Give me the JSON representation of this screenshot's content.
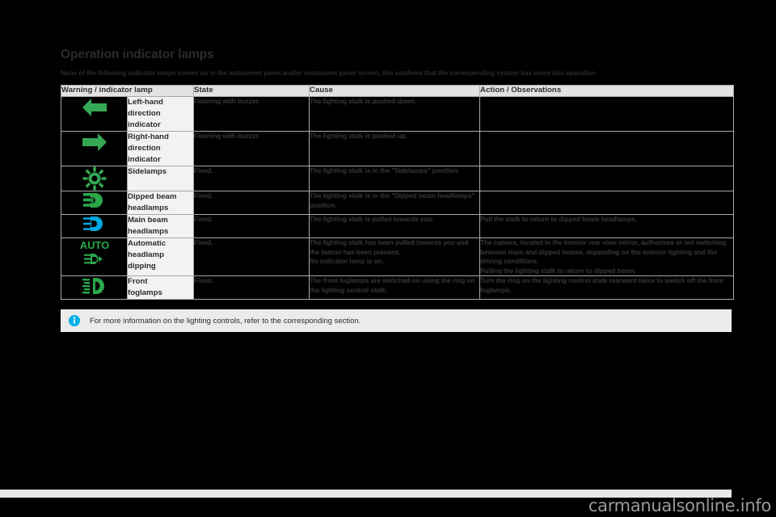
{
  "page": {
    "title": "Operation indicator lamps",
    "subtitle": "None of the following indicator lamps comes on in the instrument panel and/or instrument panel screen, this confirms that the corresponding system has come into operation."
  },
  "table": {
    "headers": {
      "warning": "Warning / indicator lamp",
      "state": "State",
      "cause": "Cause",
      "action": "Action / Observations"
    },
    "rows": [
      {
        "icon": "left-arrow-indicator-icon",
        "icon_color": "#34a853",
        "name": "Left-hand\ndirection indicator",
        "state": "Flashing with buzzer.",
        "cause": "The lighting stalk is pushed down.",
        "action": ""
      },
      {
        "icon": "right-arrow-indicator-icon",
        "icon_color": "#34a853",
        "name": "Right-hand\ndirection indicator",
        "state": "Flashing with buzzer.",
        "cause": "The lighting stalk is pushed up.",
        "action": ""
      },
      {
        "icon": "sidelamps-sunburst-icon",
        "icon_color": "#34a853",
        "name": "Sidelamps",
        "state": "Fixed.",
        "cause": "The lighting stalk is in the \"Sidelamps\" position.",
        "action": ""
      },
      {
        "icon": "dipped-beam-headlamp-icon",
        "icon_color": "#2aa84a",
        "name": "Dipped beam\nheadlamps",
        "state": "Fixed.",
        "cause": "The lighting stalk is in the \"Dipped beam headlamps\" position.",
        "action": ""
      },
      {
        "icon": "main-beam-headlamp-icon",
        "icon_color": "#00a8e0",
        "name": "Main beam\nheadlamps",
        "state": "Fixed.",
        "cause": "The lighting stalk is pulled towards you.",
        "action": "Pull the stalk to return to dipped beam headlamps."
      },
      {
        "icon": "automatic-headlamp-dipping-icon",
        "icon_color": "#2aa84a",
        "name": "Automatic\nheadlamp\ndipping",
        "state": "Fixed.",
        "cause": "The lighting stalk has been pulled towards you and the button has been pressed.\nNo indicator lamp is on.",
        "action": "The camera, located in the interior rear view mirror, authorises or not switching between main and dipped beams, depending on the exterior lighting and the driving conditions.\nPulling the lighting stalk to return to dipped beam."
      },
      {
        "icon": "front-foglamp-icon",
        "icon_color": "#2aa84a",
        "name": "Front\nfoglamps",
        "state": "Fixed.",
        "cause": "The front foglamps are switched on using the ring on the lighting control stalk.",
        "action": "Turn the ring on the lighting control stalk rearward twice to switch off the front foglamps."
      }
    ]
  },
  "footnote": {
    "icon": "info-icon",
    "icon_color": "#00b0e6",
    "text": "For more information on the lighting controls, refer to the corresponding section."
  },
  "watermark": {
    "text": "carmanualsonline.info"
  }
}
